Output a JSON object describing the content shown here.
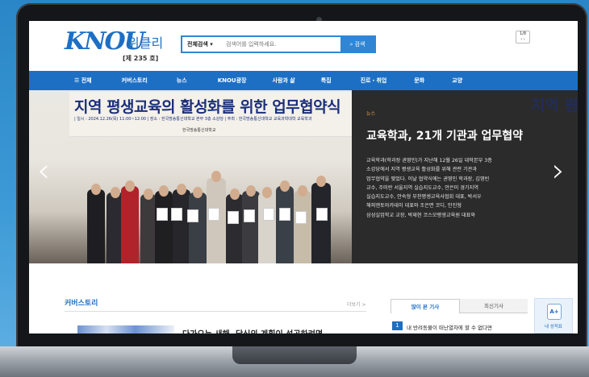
{
  "header": {
    "logo": "KNOU",
    "logo_sub": "위클리",
    "issue": "[제 235 호]",
    "search_scope": "전체검색",
    "search_placeholder": "검색어를 입력하세요.",
    "search_button": "검색",
    "page_indicator": "1/8"
  },
  "nav": {
    "items": [
      "☰ 전체",
      "커버스토리",
      "뉴스",
      "KNOU광장",
      "사람과 삶",
      "특집",
      "진로・취업",
      "문화",
      "교양"
    ]
  },
  "hero": {
    "banner_title": "지역 평생교육의 활성화를 위한 업무협약식",
    "banner_info": "| 일시 : 2024.12.26(목) 11:00~12:00 | 장소 : 한국방송통신대학교 본부 3층 소강당 | 주최 : 한국방송통신대학교 교육과학대학 교육학과",
    "banner_logo": "한국방송통신대학교",
    "category": "뉴스",
    "title": "교육학과, 21개 기관과 업무협약",
    "body": [
      "교육학과(학과장 권영민)가 지난해 12월 26일 대학본부 3층",
      "소강당에서 지역 평생교육 활성화를 위해 관련 기관과",
      "업무협약을 맺었다. 이날 협약식에는 권영민 학과장, 김영빈",
      "교수, 주미란 서울지역 실습지도교수, 안은미 경기지역",
      "실습지도교수, 안숙형 부천평생교육사협회 대표, 박서우",
      "해피엔토아카데미 대표와 조은면 코디, 안진형",
      "삼성실업학교 교장, 박재현 코스모평생교육원 대표와"
    ],
    "ghost_text": "지역 평"
  },
  "cover": {
    "heading": "커버스토리",
    "more": "더보기 >",
    "article_title": "다가오는 새해, 당신의 계획이 성공하려면"
  },
  "side": {
    "tab_popular": "많이 본 기사",
    "tab_latest": "최신기사",
    "rank": "1",
    "top_news": "내 반려동물이 떠난열차에 할 수 없다면",
    "quick_label": "내 성적표"
  }
}
